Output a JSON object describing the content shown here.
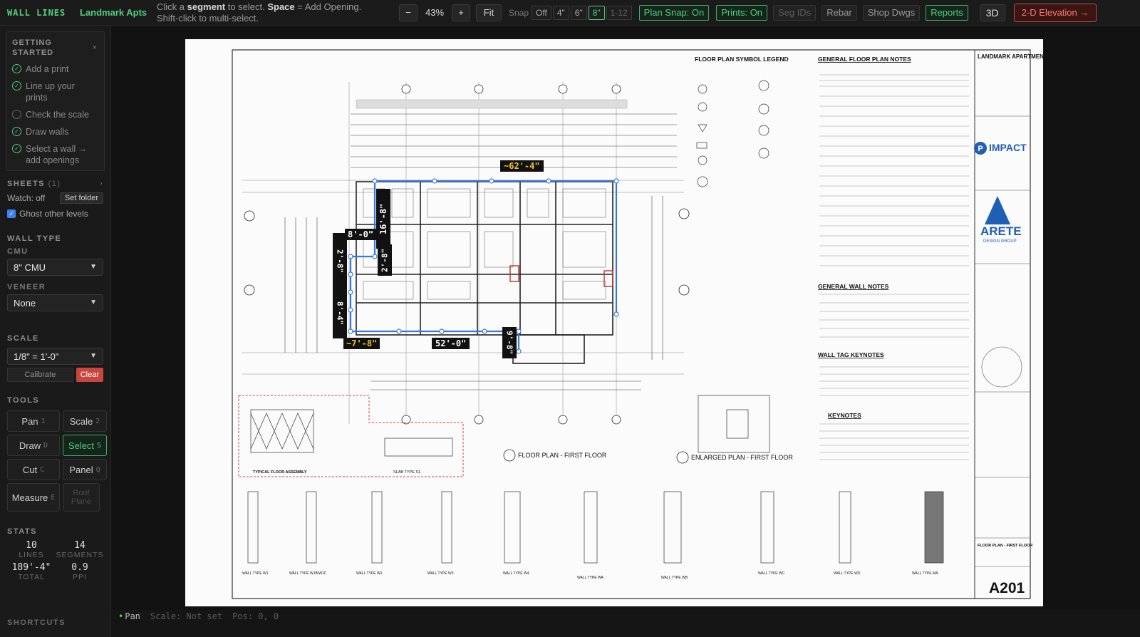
{
  "app": {
    "brand": "WALL LINES",
    "project": "Landmark Apts"
  },
  "hint": {
    "pre1": "Click a ",
    "bold1": "segment",
    "mid1": " to select. ",
    "bold2": "Space",
    "post1": " = Add Opening.",
    "line2": "Shift-click to multi-select."
  },
  "zoom": {
    "minus": "−",
    "value": "43%",
    "plus": "+",
    "fit": "Fit"
  },
  "snap": {
    "label": "Snap",
    "options": [
      "Off",
      "4\"",
      "6\"",
      "8\"",
      "1-12"
    ],
    "selected": "8\""
  },
  "toggles": {
    "plan_snap": "Plan Snap: On",
    "prints": "Prints: On",
    "seg_ids": "Seg IDs",
    "rebar": "Rebar",
    "shop_dwgs": "Shop Dwgs",
    "reports": "Reports",
    "view3d": "3D",
    "elevation": "2-D Elevation →"
  },
  "getting_started": {
    "title": "GETTING STARTED",
    "close": "×",
    "items": [
      {
        "label": "Add a print",
        "done": true
      },
      {
        "label": "Line up your prints",
        "done": true
      },
      {
        "label": "Check the scale",
        "done": false
      },
      {
        "label": "Draw walls",
        "done": true
      },
      {
        "label": "Select a wall → add openings",
        "done": true
      }
    ]
  },
  "sheets": {
    "title": "SHEETS",
    "count": "(1)",
    "watch": "Watch: off",
    "set_folder": "Set folder",
    "ghost": "Ghost other levels",
    "ghost_checked": true
  },
  "wall_type": {
    "title": "WALL TYPE",
    "cmu_label": "CMU",
    "cmu_value": "8\" CMU",
    "veneer_label": "VENEER",
    "veneer_value": "None"
  },
  "scale": {
    "title": "SCALE",
    "value": "1/8\" = 1'-0\"",
    "calibrate": "Calibrate",
    "clear": "Clear"
  },
  "tools": {
    "title": "TOOLS",
    "items": [
      {
        "label": "Pan",
        "key": "1",
        "active": false
      },
      {
        "label": "Scale",
        "key": "2",
        "active": false
      },
      {
        "label": "Draw",
        "key": "D",
        "active": false
      },
      {
        "label": "Select",
        "key": "S",
        "active": true
      },
      {
        "label": "Cut",
        "key": "C",
        "active": false
      },
      {
        "label": "Panel",
        "key": "Q",
        "active": false
      },
      {
        "label": "Measure",
        "key": "E",
        "active": false
      },
      {
        "label": "Roof Plane",
        "key": "",
        "active": false
      }
    ]
  },
  "stats": {
    "title": "STATS",
    "lines": "10",
    "lines_label": "LINES",
    "segments": "14",
    "segments_label": "SEGMENTS",
    "total": "189'-4\"",
    "total_label": "TOTAL",
    "ppi": "0.9",
    "ppi_label": "PPI"
  },
  "shortcuts": {
    "title": "SHORTCUTS"
  },
  "status": {
    "mode": "Pan",
    "scale": "Scale: Not set",
    "pos": "Pos: 0, 0"
  },
  "drawing": {
    "dims": {
      "d1": "~62'-4\"",
      "d2": "16'-8\"",
      "d3": "8'-0\"",
      "d4": "2'-8\"",
      "d5": "2'-8\"",
      "d6": "8'-4\"",
      "d7": "~7'-8\"",
      "d8": "52'-0\"",
      "d9": "9'-8\""
    },
    "legend_title": "FLOOR PLAN SYMBOL LEGEND",
    "general_notes_title": "GENERAL FLOOR PLAN NOTES",
    "wall_notes_title": "GENERAL WALL NOTES",
    "wall_tag_title": "WALL TAG KEYNOTES",
    "keynotes_title": "KEYNOTES",
    "plan_title": "FLOOR PLAN - FIRST FLOOR",
    "enlarged_title": "ENLARGED PLAN - FIRST FLOOR",
    "floor_assembly": "TYPICAL FLOOR ASSEMBLY",
    "slab_type": "SLAB TYPE S1",
    "tb_project": "LANDMARK APARTMENTS",
    "tb_impact": "IMPACT",
    "tb_arete": "ARETE",
    "tb_arete_sub": "DESIGN GROUP",
    "tb_sheet_name": "FLOOR PLAN - FIRST FLOOR",
    "tb_sheet": "A201",
    "wall_types": [
      "WALL TYPE W1",
      "WALL TYPE W1B/W1C",
      "WALL TYPE W2",
      "WALL TYPE W3",
      "WALL TYPE W4",
      "WALL TYPE WA",
      "WALL TYPE WB",
      "WALL TYPE WC",
      "WALL TYPE WD",
      "WALL TYPE MA"
    ]
  }
}
